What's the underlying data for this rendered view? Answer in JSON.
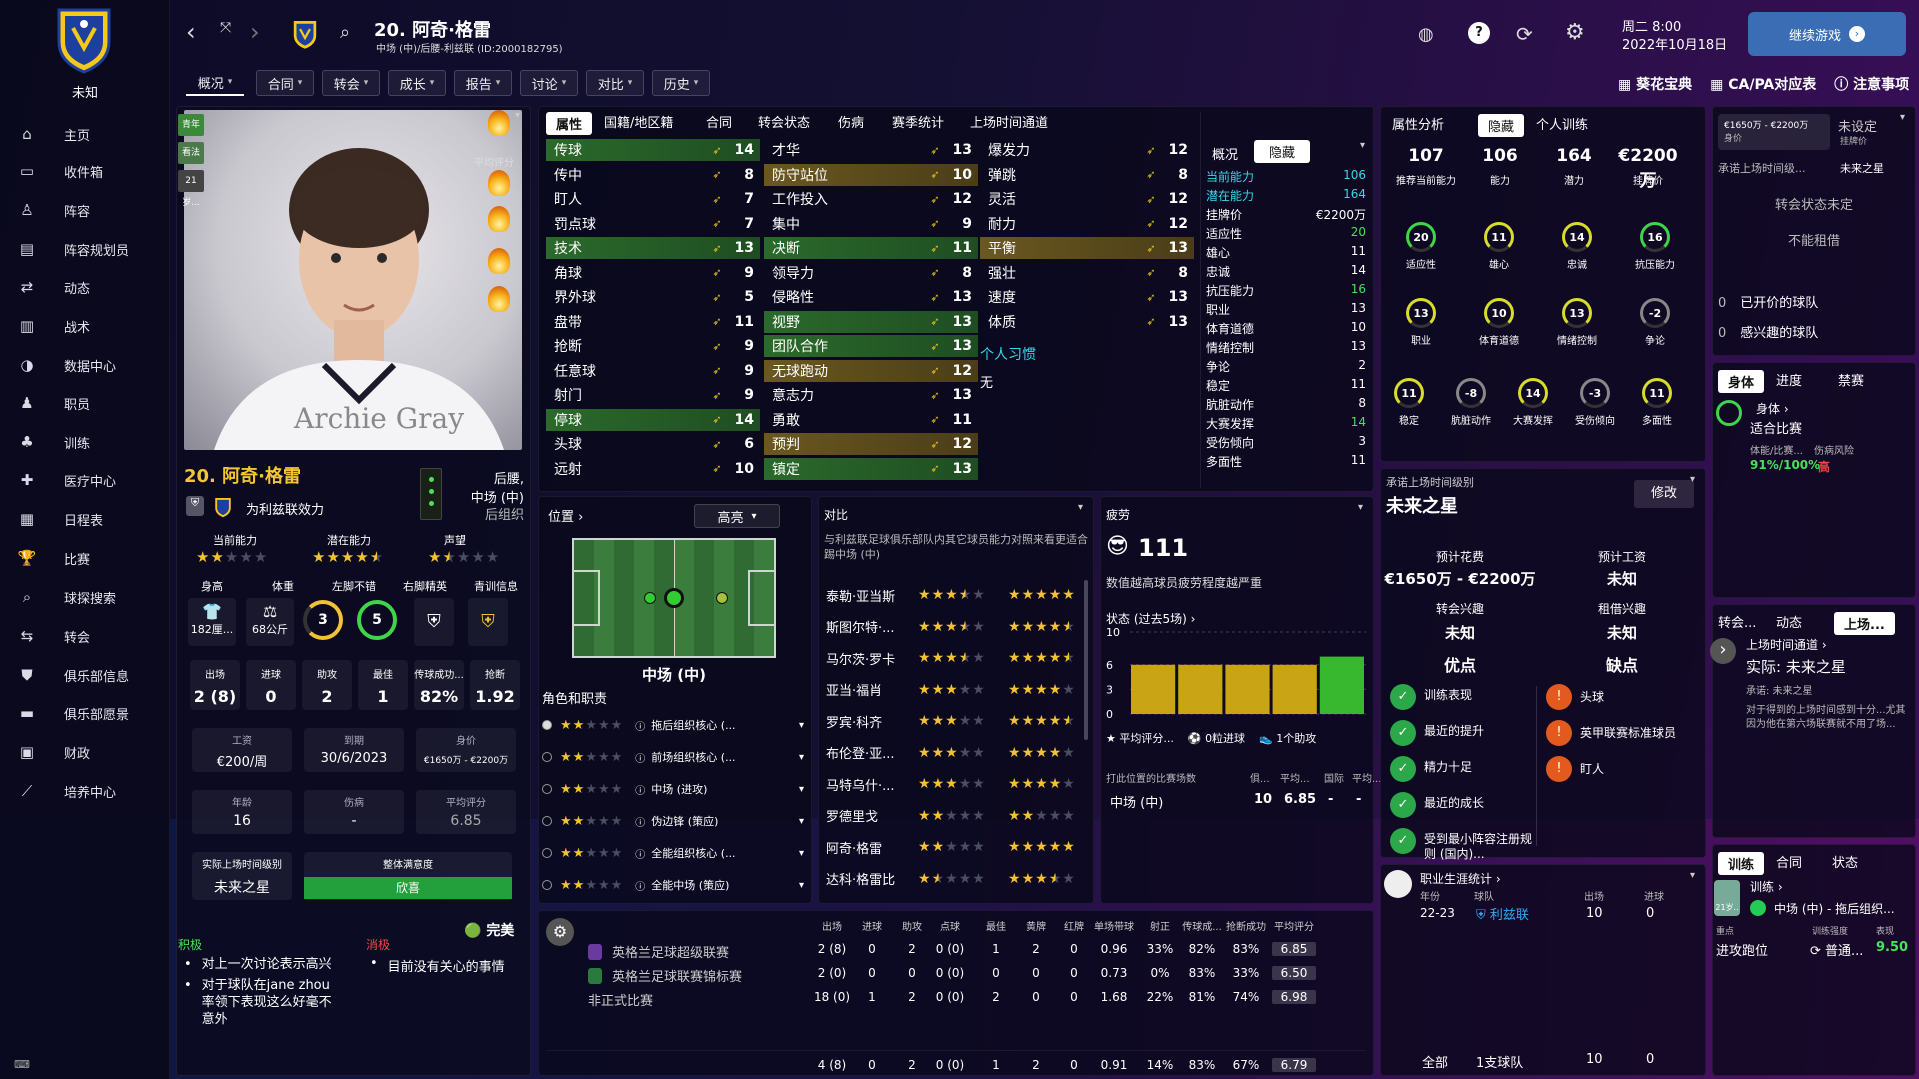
{
  "club": {
    "name": "未知"
  },
  "sidebar": {
    "items": [
      "主页",
      "收件箱",
      "阵容",
      "阵容规划员",
      "动态",
      "战术",
      "数据中心",
      "职员",
      "训练",
      "医疗中心",
      "日程表",
      "比赛",
      "球探搜索",
      "转会",
      "俱乐部信息",
      "俱乐部愿景",
      "财政",
      "培养中心"
    ],
    "icons": [
      "home-icon",
      "inbox-icon",
      "squad-icon",
      "squad-planner-icon",
      "dynamics-icon",
      "tactics-icon",
      "data-hub-icon",
      "staff-icon",
      "training-icon",
      "medical-icon",
      "schedule-icon",
      "trophy-icon",
      "scout-icon",
      "transfer-icon",
      "club-info-icon",
      "club-vision-icon",
      "finance-icon",
      "development-icon"
    ]
  },
  "header": {
    "title": "20. 阿奇·格雷",
    "subtitle": "中场 (中)/后腰-利兹联 (ID:2000182795)",
    "datetime": "周二 8:00",
    "date": "2022年10月18日",
    "continue_label": "继续游戏"
  },
  "topmenu": [
    "概况",
    "合同",
    "转会",
    "成长",
    "报告",
    "讨论",
    "对比",
    "历史"
  ],
  "toplinks": [
    "葵花宝典",
    "CA/PA对应表",
    "注意事项"
  ],
  "player": {
    "name": "20. 阿奇·格雷",
    "positions": "后腰,\n中场 (中)",
    "role_group": "后组织",
    "plays_for": "为利兹联效力",
    "photo_name": "Archie Gray",
    "badges": [
      "青年",
      "看法",
      "21岁..."
    ],
    "perf_label": "平均评分",
    "cur_ability_label": "当前能力",
    "pot_ability_label": "潜在能力",
    "reputation_label": "声望",
    "cur_stars": 2,
    "pot_stars": 4.5,
    "rep_stars": 1.5,
    "height_label": "身高",
    "weight_label": "体重",
    "left_foot_label": "左脚不错",
    "right_foot_label": "右脚精英",
    "youth_label": "青训信息",
    "height": "182厘...",
    "weight": "68公斤",
    "left_foot": "3",
    "right_foot": "5",
    "stats": [
      {
        "label": "出场",
        "value": "2 (8)"
      },
      {
        "label": "进球",
        "value": "0"
      },
      {
        "label": "助攻",
        "value": "2"
      },
      {
        "label": "最佳",
        "value": "1"
      },
      {
        "label": "传球成功...",
        "value": "82%"
      },
      {
        "label": "抢断",
        "value": "1.92"
      }
    ],
    "wage_label": "工资",
    "wage": "€200/周",
    "expiry_label": "到期",
    "expiry": "30/6/2023",
    "value_label": "身价",
    "value": "€1650万 - €2200万",
    "age_label": "年龄",
    "age": "16",
    "injury_label": "伤病",
    "injury": "-",
    "avg_label": "平均评分",
    "avg": "6.85",
    "playing_time_label": "实际上场时间级别",
    "playing_time": "未来之星",
    "satisfaction_label": "整体满意度",
    "satisfaction": "欣喜",
    "positive_label": "积极",
    "negative_label": "消极",
    "perfect_label": "完美",
    "positives": [
      "对上一次讨论表示高兴",
      "对于球队在jane zhou率领下表现这么好毫不意外"
    ],
    "negatives": [
      "目前没有关心的事情"
    ]
  },
  "attr_tabs": [
    "属性",
    "国籍/地区籍",
    "合同",
    "转会状态",
    "伤病",
    "赛季统计",
    "上场时间通道"
  ],
  "attributes": {
    "col1": [
      {
        "n": "传球",
        "v": 14,
        "h": "g"
      },
      {
        "n": "传中",
        "v": 8
      },
      {
        "n": "盯人",
        "v": 7
      },
      {
        "n": "罚点球",
        "v": 7
      },
      {
        "n": "技术",
        "v": 13,
        "h": "g"
      },
      {
        "n": "角球",
        "v": 9
      },
      {
        "n": "界外球",
        "v": 5
      },
      {
        "n": "盘带",
        "v": 11
      },
      {
        "n": "抢断",
        "v": 9
      },
      {
        "n": "任意球",
        "v": 9
      },
      {
        "n": "射门",
        "v": 9
      },
      {
        "n": "停球",
        "v": 14,
        "h": "g"
      },
      {
        "n": "头球",
        "v": 6
      },
      {
        "n": "远射",
        "v": 10
      }
    ],
    "col2": [
      {
        "n": "才华",
        "v": 13
      },
      {
        "n": "防守站位",
        "v": 10,
        "h": "o"
      },
      {
        "n": "工作投入",
        "v": 12
      },
      {
        "n": "集中",
        "v": 9
      },
      {
        "n": "决断",
        "v": 11,
        "h": "g"
      },
      {
        "n": "领导力",
        "v": 8
      },
      {
        "n": "侵略性",
        "v": 13
      },
      {
        "n": "视野",
        "v": 13,
        "h": "g"
      },
      {
        "n": "团队合作",
        "v": 13,
        "h": "g"
      },
      {
        "n": "无球跑动",
        "v": 12,
        "h": "o"
      },
      {
        "n": "意志力",
        "v": 13
      },
      {
        "n": "勇敢",
        "v": 11
      },
      {
        "n": "预判",
        "v": 12,
        "h": "o"
      },
      {
        "n": "镇定",
        "v": 13,
        "h": "g"
      }
    ],
    "col3": [
      {
        "n": "爆发力",
        "v": 12
      },
      {
        "n": "弹跳",
        "v": 8
      },
      {
        "n": "灵活",
        "v": 12
      },
      {
        "n": "耐力",
        "v": 12
      },
      {
        "n": "平衡",
        "v": 13,
        "h": "o"
      },
      {
        "n": "强壮",
        "v": 8
      },
      {
        "n": "速度",
        "v": 13
      },
      {
        "n": "体质",
        "v": 13
      }
    ],
    "habits_label": "个人习惯",
    "habits": "无"
  },
  "hidden": {
    "tabs": [
      "概况",
      "隐藏"
    ],
    "rows": [
      {
        "n": "当前能力",
        "v": "106",
        "c": "cyan"
      },
      {
        "n": "潜在能力",
        "v": "164",
        "c": "cyan"
      },
      {
        "n": "挂牌价",
        "v": "€2200万"
      },
      {
        "n": "适应性",
        "v": "20",
        "c": "green"
      },
      {
        "n": "雄心",
        "v": "11"
      },
      {
        "n": "忠诚",
        "v": "14"
      },
      {
        "n": "抗压能力",
        "v": "16",
        "c": "green"
      },
      {
        "n": "职业",
        "v": "13"
      },
      {
        "n": "体育道德",
        "v": "10"
      },
      {
        "n": "情绪控制",
        "v": "13"
      },
      {
        "n": "争论",
        "v": "2"
      },
      {
        "n": "稳定",
        "v": "11"
      },
      {
        "n": "肮脏动作",
        "v": "8"
      },
      {
        "n": "大赛发挥",
        "v": "14",
        "c": "green"
      },
      {
        "n": "受伤倾向",
        "v": "3"
      },
      {
        "n": "多面性",
        "v": "11"
      }
    ]
  },
  "position": {
    "label": "位置",
    "dropdown": "高亮",
    "pos_name": "中场 (中)",
    "roles_label": "角色和职责",
    "roles": [
      {
        "name": "拖后组织核心 (...",
        "stars": 2
      },
      {
        "name": "前场组织核心 (...",
        "stars": 2
      },
      {
        "name": "中场 (进攻)",
        "stars": 2
      },
      {
        "name": "伪边锋 (策应)",
        "stars": 2
      },
      {
        "name": "全能组织核心 (...",
        "stars": 2
      },
      {
        "name": "全能中场 (策应)",
        "stars": 2
      }
    ]
  },
  "compare": {
    "label": "对比",
    "desc": "与利兹联足球俱乐部队内其它球员能力对照来看更适合踢中场 (中)",
    "rows": [
      {
        "n": "泰勒·亚当斯",
        "a": 3.5,
        "b": 5
      },
      {
        "n": "斯图尔特·...",
        "a": 3.5,
        "b": 4.5
      },
      {
        "n": "马尔茨·罗卡",
        "a": 3.5,
        "b": 4.5
      },
      {
        "n": "亚当·福肖",
        "a": 3,
        "b": 4
      },
      {
        "n": "罗宾·科齐",
        "a": 3,
        "b": 4.5
      },
      {
        "n": "布伦登·亚...",
        "a": 3,
        "b": 4
      },
      {
        "n": "马特乌什·...",
        "a": 3,
        "b": 4
      },
      {
        "n": "罗德里戈",
        "a": 2,
        "b": 2
      },
      {
        "n": "阿奇·格雷",
        "a": 2,
        "b": 5
      },
      {
        "n": "达科·格雷比",
        "a": 1.5,
        "b": 3.5
      }
    ]
  },
  "fatigue": {
    "label": "疲劳",
    "value": "111",
    "desc": "数值越高球员疲劳程度越严重",
    "form_label": "状态 (过去5场)",
    "form": [
      6,
      6,
      6,
      6,
      7
    ],
    "form_ylim": [
      0,
      10
    ],
    "form_ticks": [
      "10",
      "6",
      "3",
      "0"
    ],
    "legend": [
      "平均评分...",
      "0粒进球",
      "1个助攻"
    ],
    "pos_stats": {
      "headers": [
        "打此位置的比赛场数",
        "俱...",
        "平均...",
        "国际",
        "平均..."
      ],
      "row": [
        "中场 (中)",
        "10",
        "6.85",
        "-",
        "-"
      ]
    }
  },
  "season": {
    "headers": [
      "出场",
      "进球",
      "助攻",
      "点球",
      "最佳",
      "黄牌",
      "红牌",
      "单场带球",
      "射正",
      "传球成...",
      "抢断成功",
      "平均评分"
    ],
    "rows": [
      {
        "n": "英格兰足球超级联赛",
        "v": [
          "2 (8)",
          "0",
          "2",
          "0 (0)",
          "1",
          "2",
          "0",
          "0.96",
          "33%",
          "82%",
          "83%",
          "6.85"
        ]
      },
      {
        "n": "英格兰足球联赛锦标赛",
        "v": [
          "2 (0)",
          "0",
          "0",
          "0 (0)",
          "0",
          "0",
          "0",
          "0.73",
          "0%",
          "83%",
          "33%",
          "6.50"
        ]
      },
      {
        "n": "非正式比赛",
        "v": [
          "18 (0)",
          "1",
          "2",
          "0 (0)",
          "2",
          "0",
          "0",
          "1.68",
          "22%",
          "81%",
          "74%",
          "6.98"
        ]
      }
    ],
    "total": [
      "4 (8)",
      "0",
      "2",
      "0 (0)",
      "1",
      "2",
      "0",
      "0.91",
      "14%",
      "83%",
      "67%",
      "6.79"
    ]
  },
  "analysis": {
    "tabs": [
      "属性分析",
      "隐藏",
      "个人训练"
    ],
    "top": [
      {
        "v": "107",
        "l": "推荐当前能力"
      },
      {
        "v": "106",
        "l": "能力"
      },
      {
        "v": "164",
        "l": "潜力"
      },
      {
        "v": "€2200万",
        "l": "挂牌价"
      }
    ],
    "gauges": [
      {
        "v": "20",
        "l": "适应性"
      },
      {
        "v": "11",
        "l": "雄心"
      },
      {
        "v": "14",
        "l": "忠诚"
      },
      {
        "v": "16",
        "l": "抗压能力"
      },
      {
        "v": "13",
        "l": "职业"
      },
      {
        "v": "10",
        "l": "体育道德"
      },
      {
        "v": "13",
        "l": "情绪控制"
      },
      {
        "v": "-2",
        "l": "争论"
      },
      {
        "v": "11",
        "l": "稳定"
      },
      {
        "v": "-8",
        "l": "肮脏动作"
      },
      {
        "v": "14",
        "l": "大赛发挥"
      },
      {
        "v": "-3",
        "l": "受伤倾向"
      },
      {
        "v": "11",
        "l": "多面性"
      }
    ]
  },
  "promise": {
    "label": "承诺上场时间级别",
    "value": "未来之星",
    "edit": "修改",
    "fee_label": "预计花费",
    "fee": "€1650万 - €2200万",
    "wage_label": "预计工资",
    "wage": "未知",
    "transfer_label": "转会兴趣",
    "transfer": "未知",
    "loan_label": "租借兴趣",
    "loan": "未知",
    "pros_label": "优点",
    "cons_label": "缺点",
    "pros": [
      "训练表现",
      "最近的提升",
      "精力十足",
      "最近的成长",
      "受到最小阵容注册规则 (国内)..."
    ],
    "cons": [
      "头球",
      "英甲联赛标准球员",
      "盯人"
    ]
  },
  "career": {
    "label": "职业生涯统计",
    "year_label": "年份",
    "club_label": "球队",
    "apps_label": "出场",
    "goals_label": "进球",
    "year": "22-23",
    "club": "利兹联",
    "apps": "10",
    "goals": "0",
    "total_label": "全部",
    "total_clubs": "1支球队",
    "total_apps": "10",
    "total_goals": "0"
  },
  "right": {
    "value_label": "身价",
    "value": "€1650万 - €2200万",
    "asking_label": "挂牌价",
    "asking": "未设定",
    "promise_hint": "承诺上场时间级...",
    "promise_val": "未来之星",
    "transfer_status": "转会状态未定",
    "loan": "不能租借",
    "clubs_bid": {
      "n": "0",
      "l": "已开价的球队"
    },
    "clubs_int": {
      "n": "0",
      "l": "感兴趣的球队"
    },
    "body_tabs": [
      "身体",
      "进度",
      "禁赛"
    ],
    "body_label": "身体",
    "body_status": "适合比赛",
    "fit_label": "体能/比赛...",
    "risk_label": "伤病风险",
    "fit": "91%/100%",
    "risk": "高",
    "news_tabs": [
      "转会...",
      "动态",
      "上场..."
    ],
    "pt_label": "上场时间通道",
    "pt_actual": "实际: 未来之星",
    "pt_promise": "承诺: 未来之星",
    "pt_desc": "对于得到的上场时间感到十分...尤其因为他在第六场联赛就不用了场...",
    "train_tabs": [
      "训练",
      "合同",
      "状态"
    ],
    "train_label": "训练",
    "train_role": "中场 (中) - 拖后组织...",
    "focus_label": "重点",
    "intensity_label": "训练强度",
    "perf_label": "表现",
    "focus": "进攻跑位",
    "intensity": "普通...",
    "perf": "9.50"
  }
}
